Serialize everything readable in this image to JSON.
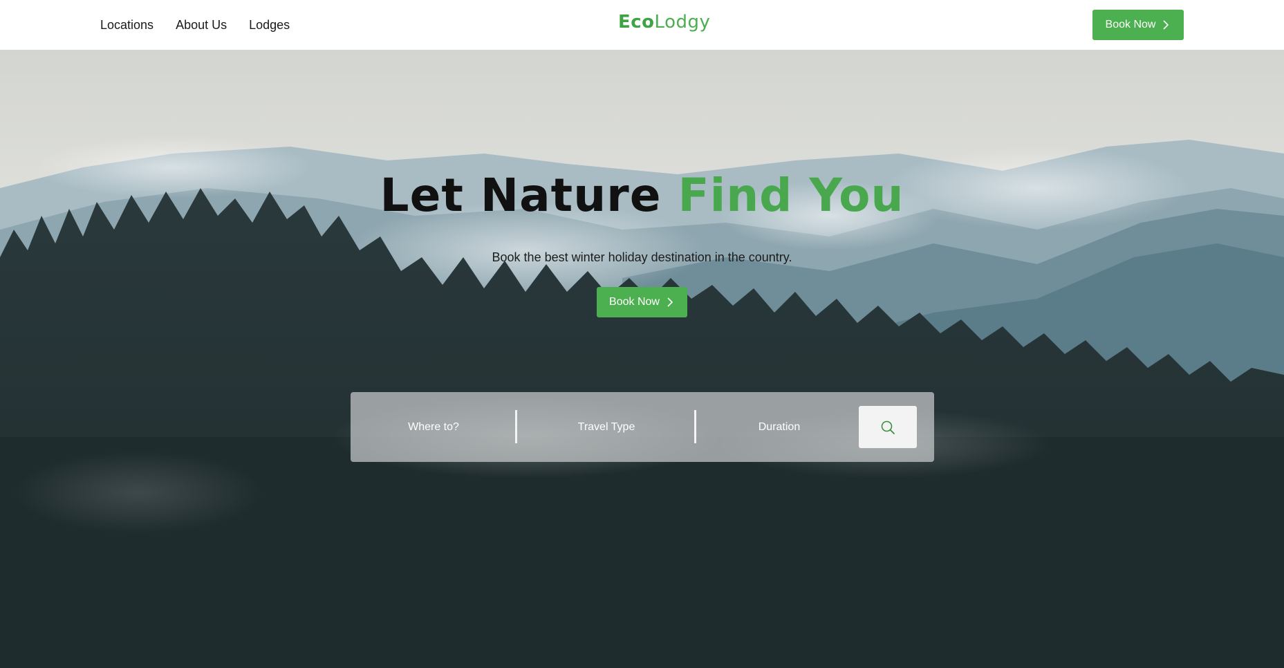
{
  "nav": {
    "links": [
      "Locations",
      "About Us",
      "Lodges"
    ]
  },
  "logo": {
    "part1": "Eco",
    "part2": "Lodgy"
  },
  "header": {
    "book_label": "Book Now"
  },
  "hero": {
    "title_part1": "Let Nature ",
    "title_part2": "Find You",
    "subtitle": "Book the best winter holiday destination in the country.",
    "book_label": "Book Now"
  },
  "search": {
    "where": "Where to?",
    "travel_type": "Travel Type",
    "duration": "Duration",
    "button_icon": "search-icon"
  },
  "colors": {
    "accent": "#4caf50",
    "header_bg": "#ffffff",
    "forest_dark": "#1f2c2e"
  }
}
